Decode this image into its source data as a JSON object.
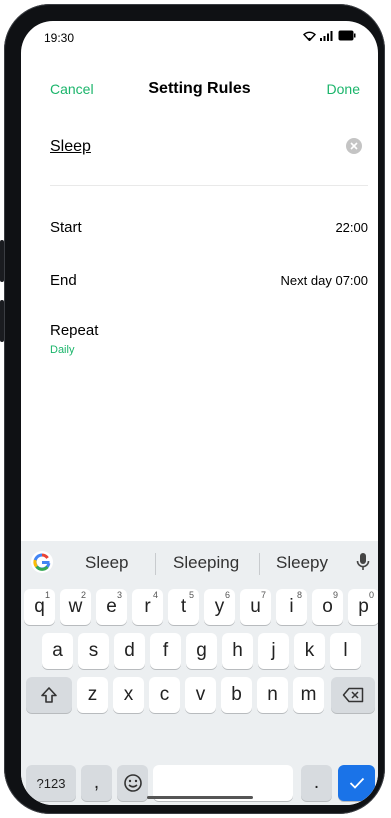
{
  "status": {
    "time": "19:30"
  },
  "header": {
    "cancel": "Cancel",
    "title": "Setting Rules",
    "done": "Done"
  },
  "rule": {
    "name": "Sleep"
  },
  "settings": {
    "start": {
      "label": "Start",
      "value": "22:00"
    },
    "end": {
      "label": "End",
      "value": "Next day 07:00"
    },
    "repeat": {
      "label": "Repeat",
      "value": "Daily"
    }
  },
  "keyboard": {
    "suggestions": [
      "Sleep",
      "Sleeping",
      "Sleepy"
    ],
    "row1": [
      "q",
      "w",
      "e",
      "r",
      "t",
      "y",
      "u",
      "i",
      "o",
      "p"
    ],
    "row1_hints": [
      "1",
      "2",
      "3",
      "4",
      "5",
      "6",
      "7",
      "8",
      "9",
      "0"
    ],
    "row2": [
      "a",
      "s",
      "d",
      "f",
      "g",
      "h",
      "j",
      "k",
      "l"
    ],
    "row3": [
      "z",
      "x",
      "c",
      "v",
      "b",
      "n",
      "m"
    ],
    "bottom": {
      "symbols": "?123",
      "comma": ",",
      "period": "."
    }
  },
  "colors": {
    "accent": "#1bb56b",
    "keyboard_bg": "#eceff1",
    "enter_key": "#1a73e8"
  }
}
